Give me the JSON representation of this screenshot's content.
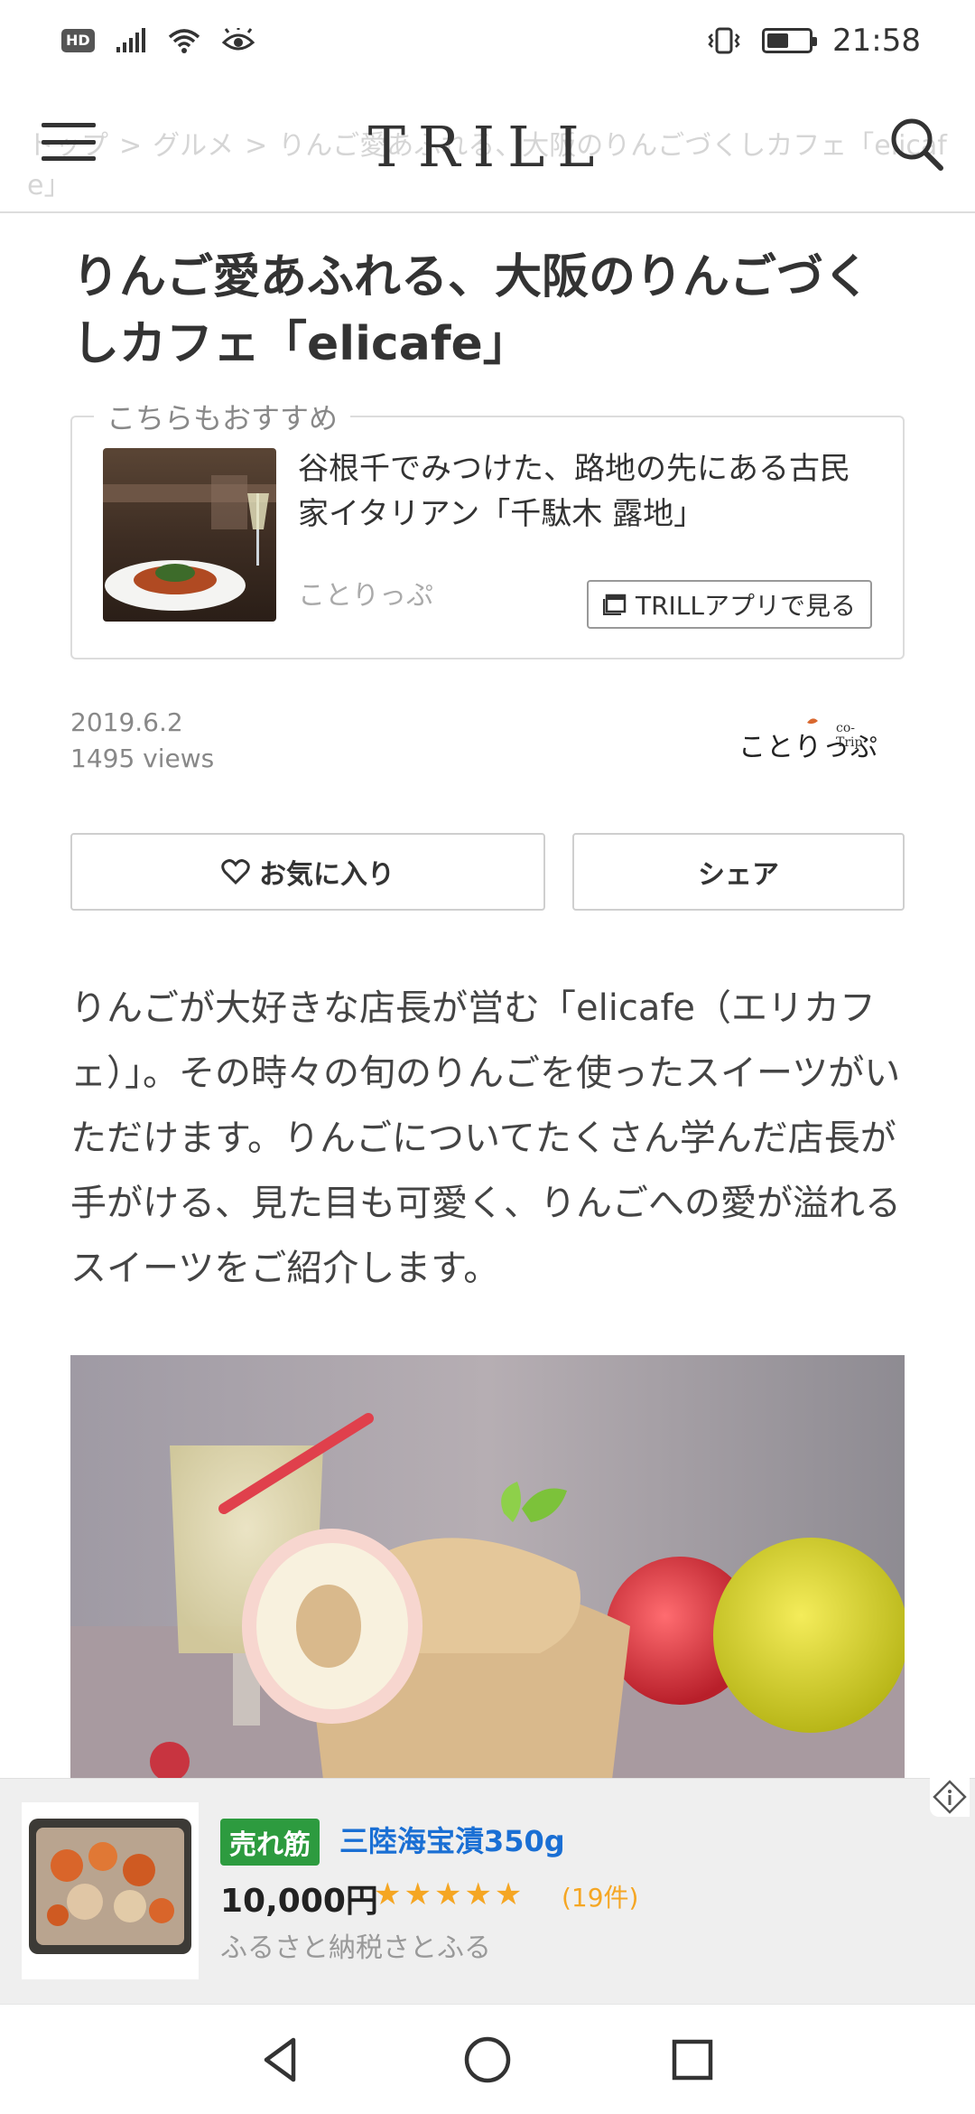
{
  "status_bar": {
    "hd": "HD",
    "time": "21:58"
  },
  "header": {
    "logo": "TRILL",
    "breadcrumb": [
      "トップ",
      "グルメ",
      "りんご愛あふれる、大阪のりんごづくしカフェ「elicafe」"
    ],
    "breadcrumb_sep": ">"
  },
  "article": {
    "title": "りんご愛あふれる、大阪のりんごづくしカフェ「elicafe」",
    "recommend": {
      "legend": "こちらもおすすめ",
      "title": "谷根千でみつけた、路地の先にある古民家イタリアン「千駄木 露地」",
      "source": "ことりっぷ",
      "app_button": "TRILLアプリで見る"
    },
    "date": "2019.6.2",
    "views": "1495 views",
    "publisher_logo_jp": "ことりっぷ",
    "publisher_logo_en": "co-Trip",
    "favorite_button": "お気に入り",
    "share_button": "シェア",
    "lead": "りんごが大好きな店長が営む「elicafe（エリカフェ）」。その時々の旬のりんごを使ったスイーツがいただけます。りんごについてたくさん学んだ店長が手がける、見た目も可愛く、りんごへの愛が溢れるスイーツをご紹介します。"
  },
  "ad": {
    "badge": "売れ筋",
    "product": "三陸海宝漬350g",
    "price": "10,000円",
    "stars": "★★★★★",
    "rating": 5,
    "count": "(19件)",
    "shop": "ふるさと納税さとふる"
  },
  "colors": {
    "accent_green": "#2d9b3f",
    "link_blue": "#1a6fd4",
    "star_orange": "#f5a623"
  },
  "icons": [
    "signal-icon",
    "wifi-icon",
    "eye-icon",
    "vibrate-icon",
    "battery-icon",
    "menu-icon",
    "search-icon",
    "app-window-icon",
    "heart-icon",
    "info-icon",
    "back-icon",
    "home-icon",
    "recents-icon"
  ]
}
